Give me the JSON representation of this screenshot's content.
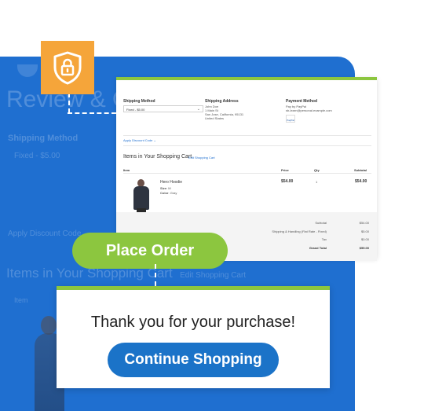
{
  "background": {
    "title": "Review & Order",
    "shipping_method_label": "Shipping Method",
    "shipping_fixed": "Fixed - $5.00",
    "apply_discount": "Apply Discount Code",
    "items_heading": "Items in Your Shopping Cart",
    "edit_cart": "Edit Shopping Cart",
    "item_col": "Item"
  },
  "review": {
    "shipping_method": {
      "heading": "Shipping Method",
      "selected": "Fixed - $5.00"
    },
    "shipping_address": {
      "heading": "Shipping Address",
      "lines": [
        "John Doe",
        "1 Main St",
        "San Jose, California, 95131",
        "United States"
      ]
    },
    "payment_method": {
      "heading": "Payment Method",
      "lines": [
        "Pay by PayPal",
        "sb-learn@personal.example.com"
      ],
      "logo": "PayPal"
    },
    "apply_discount": "Apply Discount Code",
    "items_title": "Items in Your Shopping Cart",
    "edit_cart": "Edit Shopping Cart",
    "columns": {
      "item": "Item",
      "price": "Price",
      "qty": "Qty",
      "subtotal": "Subtotal"
    },
    "item": {
      "name": "Hero Hoodie",
      "size_label": "Size",
      "size": "M",
      "color_label": "Color",
      "color": "Gray",
      "price": "$54.00",
      "qty": "1",
      "subtotal": "$54.00"
    },
    "totals": [
      {
        "label": "Subtotal",
        "value": "$54.00"
      },
      {
        "label": "Shipping & Handling (Flat Rate - Fixed)",
        "value": "$5.00"
      },
      {
        "label": "Tax",
        "value": "$0.00"
      },
      {
        "label": "Grand Total",
        "value": "$59.00"
      }
    ]
  },
  "place_order_label": "Place Order",
  "thanks": {
    "message": "Thank you for your purchase!",
    "continue_label": "Continue Shopping"
  },
  "colors": {
    "blue_panel": "#1f6fd0",
    "green_accent": "#8cc63f",
    "shield_orange": "#f5a53a",
    "continue_blue": "#1b73c8"
  },
  "icons": {
    "shield": "lock-shield-icon",
    "chevron": "chevron-down-icon"
  }
}
